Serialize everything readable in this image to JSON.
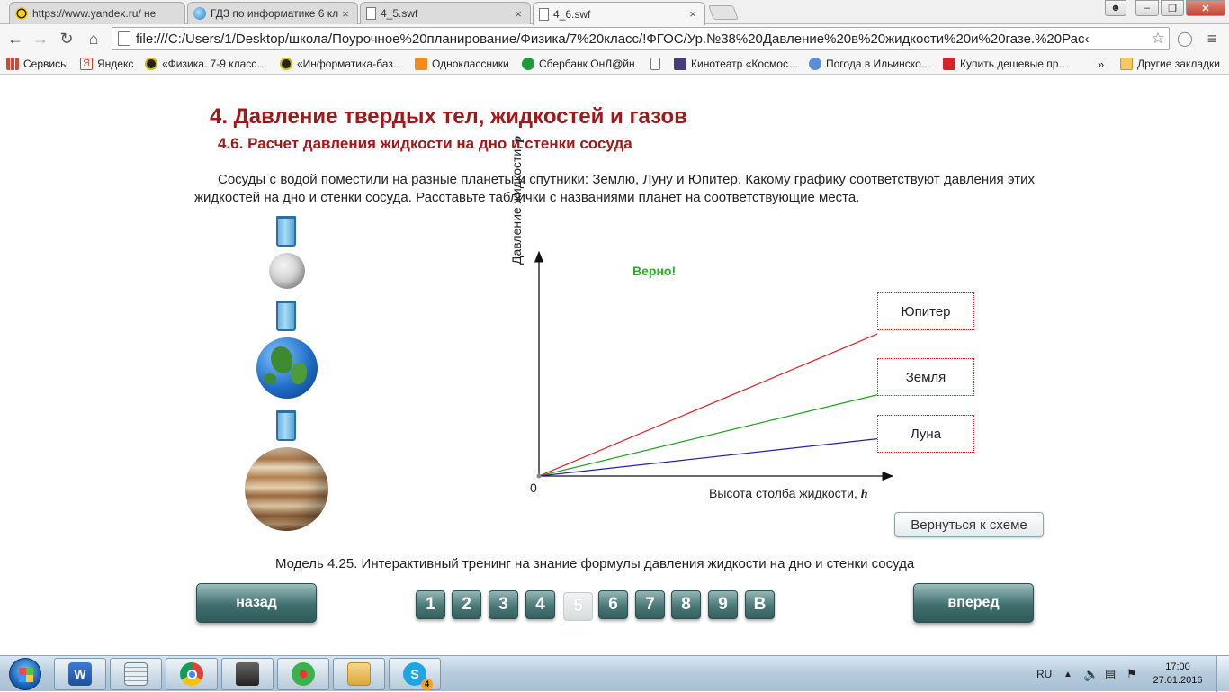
{
  "browser": {
    "tabs": [
      {
        "title": "https://www.yandex.ru/ не",
        "icon": "yandex-icon"
      },
      {
        "title": "ГДЗ по информатике 6 кл",
        "icon": "globe-icon"
      },
      {
        "title": "4_5.swf",
        "icon": "page-icon"
      },
      {
        "title": "4_6.swf",
        "icon": "page-icon",
        "active": true
      }
    ],
    "url": "file:///C:/Users/1/Desktop/школа/Поурочное%20планирование/Физика/7%20класс/!ФГОС/Ур.№38%20Давление%20в%20жидкости%20и%20газе.%20Рас‹",
    "bookmarks": [
      {
        "label": "Сервисы",
        "color": "#d34836"
      },
      {
        "label": "Яндекс",
        "color": "#e03b2e"
      },
      {
        "label": "«Физика. 7-9 класс…",
        "color": "#222222"
      },
      {
        "label": "«Информатика-баз…",
        "color": "#222222"
      },
      {
        "label": "Одноклассники",
        "color": "#f28a1e"
      },
      {
        "label": "Сбербанк ОнЛ@йн",
        "color": "#1f9a3a"
      },
      {
        "label": "",
        "color": "#ffffff"
      },
      {
        "label": "Кинотеатр «Космос…",
        "color": "#4a3b7a"
      },
      {
        "label": "Погода в Ильинско…",
        "color": "#5a8fd6"
      },
      {
        "label": "Купить дешевые пр…",
        "color": "#d0262a"
      }
    ],
    "more_chevron": "»",
    "other_bookmarks": "Другие закладки"
  },
  "page": {
    "title": "4. Давление твердых тел, жидкостей и газов",
    "subtitle": "4.6. Расчет давления жидкости на дно и стенки сосуда",
    "task": "Сосуды с водой поместили на разные планеты и спутники: Землю, Луну и Юпитер. Какому графику соответствуют давления этих жидкостей на дно и стенки сосуда. Расставьте таблички с названиями планет на соответствующие места.",
    "graph": {
      "y_label": "Давление жидкости, ",
      "y_var": "p",
      "x_label": "Высота столба жидкости, ",
      "x_var": "h",
      "origin": "0",
      "verdict": "Верно!",
      "verdict_color": "#22b322",
      "lines": [
        {
          "name": "Юпитер",
          "color": "#e02020",
          "slope": 0.42
        },
        {
          "name": "Земля",
          "color": "#20a020",
          "slope": 0.24
        },
        {
          "name": "Луна",
          "color": "#2020b0",
          "slope": 0.11
        }
      ]
    },
    "back_to_scheme": "Вернуться к схеме",
    "caption": "Модель 4.25. Интерактивный тренинг на знание формулы давления жидкости на дно и стенки сосуда",
    "nav": {
      "back": "назад",
      "forward": "вперед",
      "pages": [
        "1",
        "2",
        "3",
        "4",
        "5",
        "6",
        "7",
        "8",
        "9",
        "В"
      ],
      "current_page": "5"
    }
  },
  "taskbar": {
    "apps": [
      "word-icon",
      "calculator-icon",
      "chrome-icon",
      "scanner-icon",
      "icq-icon",
      "explorer-icon",
      "skype-icon"
    ],
    "skype_badge": "4",
    "lang": "RU",
    "time": "17:00",
    "date": "27.01.2016"
  }
}
